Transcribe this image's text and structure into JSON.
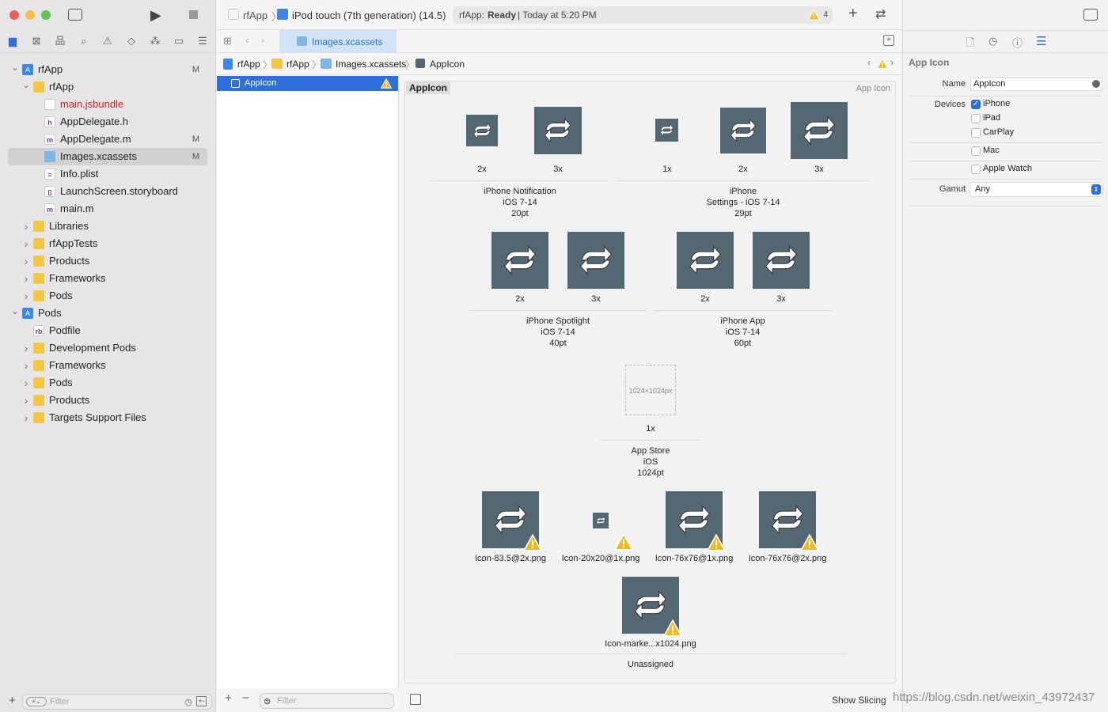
{
  "colors": {
    "accent": "#2f6fdb",
    "icon_bg": "#546874",
    "warning": "#f2b91e",
    "modified_red": "#d0201a"
  },
  "toolbar": {
    "scheme": "rfApp",
    "device": "iPod touch (7th generation) (14.5)",
    "status_app": "rfApp:",
    "status_state": "Ready",
    "status_time": "| Today at 5:20 PM",
    "warning_count": "4"
  },
  "tab": {
    "label": "Images.xcassets"
  },
  "jumpbar": [
    "rfApp",
    "rfApp",
    "Images.xcassets",
    "AppIcon"
  ],
  "sidebar": {
    "filter_placeholder": "Filter",
    "items": [
      {
        "label": "rfApp",
        "level": 0,
        "icon": "proj",
        "open": true,
        "badge": "M"
      },
      {
        "label": "rfApp",
        "level": 1,
        "icon": "folder",
        "open": true,
        "badge": ""
      },
      {
        "label": "main.jsbundle",
        "level": 2,
        "icon": "blank",
        "badge": "",
        "red": true
      },
      {
        "label": "AppDelegate.h",
        "level": 2,
        "icon": "h",
        "badge": ""
      },
      {
        "label": "AppDelegate.m",
        "level": 2,
        "icon": "m",
        "badge": "M"
      },
      {
        "label": "Images.xcassets",
        "level": 2,
        "icon": "xc",
        "badge": "M",
        "selected": true
      },
      {
        "label": "Info.plist",
        "level": 2,
        "icon": "plist",
        "badge": ""
      },
      {
        "label": "LaunchScreen.storyboard",
        "level": 2,
        "icon": "sb",
        "badge": ""
      },
      {
        "label": "main.m",
        "level": 2,
        "icon": "m",
        "badge": ""
      },
      {
        "label": "Libraries",
        "level": 1,
        "icon": "folder",
        "open": false,
        "badge": ""
      },
      {
        "label": "rfAppTests",
        "level": 1,
        "icon": "folder",
        "open": false,
        "badge": ""
      },
      {
        "label": "Products",
        "level": 1,
        "icon": "folder",
        "open": false,
        "badge": ""
      },
      {
        "label": "Frameworks",
        "level": 1,
        "icon": "folder",
        "open": false,
        "badge": ""
      },
      {
        "label": "Pods",
        "level": 1,
        "icon": "folder",
        "open": false,
        "badge": ""
      },
      {
        "label": "Pods",
        "level": 0,
        "icon": "proj",
        "open": true,
        "badge": ""
      },
      {
        "label": "Podfile",
        "level": 1,
        "icon": "rb",
        "badge": ""
      },
      {
        "label": "Development Pods",
        "level": 1,
        "icon": "folder",
        "open": false,
        "badge": ""
      },
      {
        "label": "Frameworks",
        "level": 1,
        "icon": "folder",
        "open": false,
        "badge": ""
      },
      {
        "label": "Pods",
        "level": 1,
        "icon": "folder",
        "open": false,
        "badge": ""
      },
      {
        "label": "Products",
        "level": 1,
        "icon": "folder",
        "open": false,
        "badge": ""
      },
      {
        "label": "Targets Support Files",
        "level": 1,
        "icon": "folder",
        "open": false,
        "badge": ""
      }
    ]
  },
  "outline": {
    "items": [
      {
        "label": "AppIcon",
        "warning": true
      }
    ],
    "filter_placeholder": "Filter"
  },
  "asset": {
    "title": "AppIcon",
    "type_label": "App Icon",
    "groups": [
      {
        "lines": [
          "iPhone Notification",
          "iOS 7-14",
          "20pt"
        ],
        "slots": [
          "2x",
          "3x"
        ]
      },
      {
        "lines": [
          "iPhone",
          "Settings - iOS 7-14",
          "29pt"
        ],
        "slots": [
          "1x",
          "2x",
          "3x"
        ]
      },
      {
        "lines": [
          "iPhone Spotlight",
          "iOS 7-14",
          "40pt"
        ],
        "slots": [
          "2x",
          "3x"
        ]
      },
      {
        "lines": [
          "iPhone App",
          "iOS 7-14",
          "60pt"
        ],
        "slots": [
          "2x",
          "3x"
        ]
      },
      {
        "lines": [
          "App Store",
          "iOS",
          "1024pt"
        ],
        "slots": [
          "1x"
        ],
        "placeholder": "1024×1024px"
      }
    ],
    "unassigned_label": "Unassigned",
    "unassigned": [
      "Icon-83.5@2x.png",
      "Icon-20x20@1x.png",
      "Icon-76x76@1x.png",
      "Icon-76x76@2x.png",
      "Icon-marke...x1024.png"
    ],
    "show_slicing": "Show Slicing"
  },
  "inspector": {
    "title": "App Icon",
    "name_label": "Name",
    "name_value": "AppIcon",
    "devices_label": "Devices",
    "devices": [
      {
        "label": "iPhone",
        "checked": true
      },
      {
        "label": "iPad",
        "checked": false
      },
      {
        "label": "CarPlay",
        "checked": false
      },
      {
        "label": "Mac",
        "checked": false
      },
      {
        "label": "Apple Watch",
        "checked": false
      }
    ],
    "gamut_label": "Gamut",
    "gamut_value": "Any"
  },
  "watermark": "https://blog.csdn.net/weixin_43972437"
}
